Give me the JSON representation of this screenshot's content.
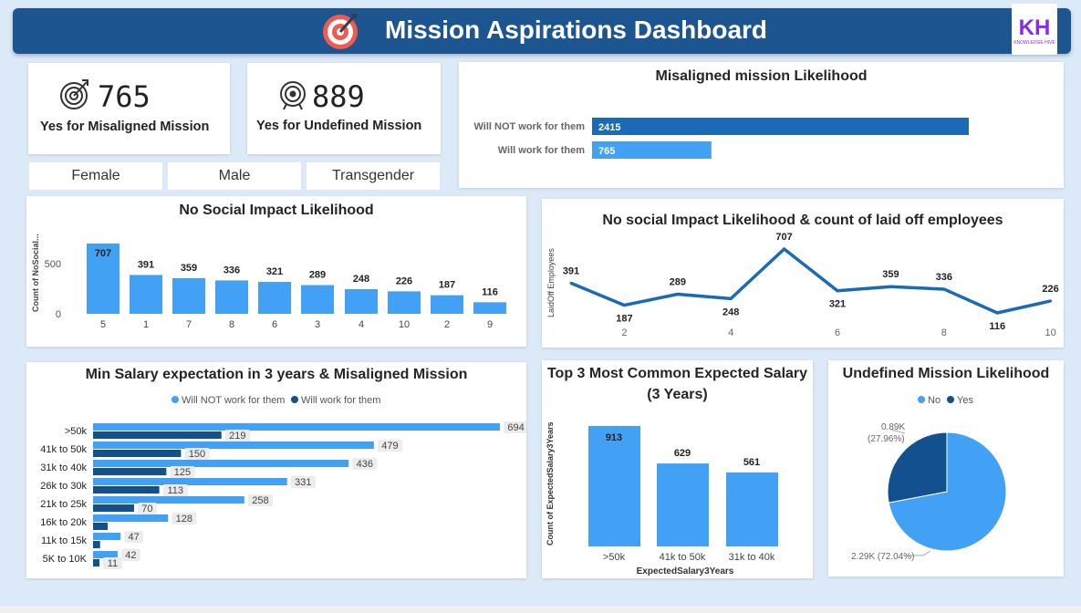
{
  "header": {
    "title": "Mission Aspirations Dashboard",
    "logo_text": "KH",
    "logo_sub": "KNOWLEDGE HIVE"
  },
  "kpis": [
    {
      "value": "765",
      "label": "Yes for Misaligned Mission",
      "icon": "target-dart-icon"
    },
    {
      "value": "889",
      "label": "Yes for Undefined Mission",
      "icon": "target-icon"
    }
  ],
  "slicers": [
    "Female",
    "Male",
    "Transgender"
  ],
  "colors": {
    "dark": "#12508f",
    "light": "#42a0f5",
    "mid": "#1a6ab8",
    "header": "#1d5590"
  },
  "misaligned": {
    "title": "Misaligned mission Likelihood",
    "chart_data": {
      "type": "bar",
      "categories": [
        "Will NOT work for them",
        "Will work for them"
      ],
      "values": [
        2415,
        765
      ]
    }
  },
  "no_social": {
    "title": "No Social Impact Likelihood",
    "ylabel": "Count of NoSocial...",
    "chart_data": {
      "type": "bar",
      "categories": [
        "5",
        "1",
        "7",
        "8",
        "6",
        "3",
        "4",
        "10",
        "2",
        "9"
      ],
      "values": [
        707,
        391,
        359,
        336,
        321,
        289,
        248,
        226,
        187,
        116
      ],
      "yticks": [
        "0",
        "500"
      ]
    }
  },
  "laidoff": {
    "title": "No social Impact Likelihood & count of laid off employees",
    "ylabel": "LaidOff Employees",
    "chart_data": {
      "type": "line",
      "x": [
        1,
        2,
        3,
        4,
        5,
        6,
        7,
        8,
        9,
        10
      ],
      "values": [
        391,
        187,
        289,
        248,
        707,
        321,
        359,
        336,
        116,
        226
      ],
      "xticks": [
        "2",
        "4",
        "6",
        "8",
        "10"
      ]
    }
  },
  "salary": {
    "title": "Min Salary expectation in 3 years & Misaligned Mission",
    "legend": [
      "Will NOT work for them",
      "Will work for them"
    ],
    "chart_data": {
      "type": "bar",
      "categories": [
        ">50k",
        "41k to 50k",
        "31k to 40k",
        "26k to 30k",
        "21k to 25k",
        "16k to 20k",
        "11k to 15k",
        "5K to 10K"
      ],
      "series": [
        {
          "name": "Will NOT work for them",
          "values": [
            694,
            479,
            436,
            331,
            258,
            128,
            47,
            42
          ],
          "labels": [
            "694",
            "479",
            "436",
            "331",
            "258",
            "128",
            "47",
            "42"
          ]
        },
        {
          "name": "Will work for them",
          "values": [
            219,
            150,
            125,
            113,
            70,
            25,
            12,
            11
          ],
          "labels": [
            "219",
            "150",
            "125",
            "113",
            "70",
            "",
            "",
            "11"
          ]
        }
      ]
    }
  },
  "top3": {
    "title_line1": "Top 3 Most Common Expected Salary",
    "title_line2": "(3 Years)",
    "ylabel": "Count of ExpectedSalary3Years",
    "xlabel": "ExpectedSalary3Years",
    "chart_data": {
      "type": "bar",
      "categories": [
        ">50k",
        "41k to 50k",
        "31k to 40k"
      ],
      "values": [
        913,
        629,
        561
      ]
    }
  },
  "undefined": {
    "title": "Undefined Mission Likelihood",
    "legend": [
      "No",
      "Yes"
    ],
    "chart_data": {
      "type": "pie",
      "categories": [
        "No",
        "Yes"
      ],
      "values": [
        2290,
        890
      ],
      "labels": [
        "2.29K (72.04%)",
        "0.89K (27.96%)"
      ]
    }
  }
}
